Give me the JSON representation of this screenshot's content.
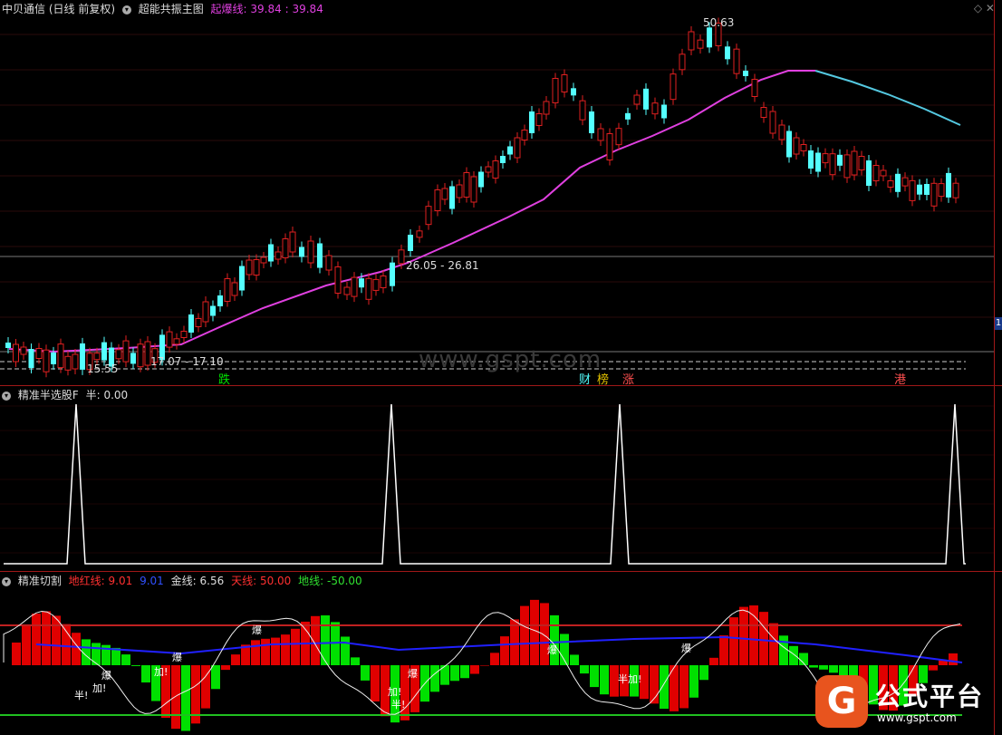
{
  "panel1": {
    "stock_name": "中贝通信",
    "period": "(日线 前复权)",
    "indicator": "超能共振主图",
    "line_label": "起爆线:",
    "value1": "39.84",
    "sep": ":",
    "value2": "39.84",
    "high_label": "50.63",
    "low_label": "15.55",
    "range1": "17.07 - 17.10",
    "range2": "26.05 - 26.81",
    "watermark": "www.gspt.com",
    "tags": [
      "跌",
      "财",
      "榜",
      "涨",
      "港"
    ],
    "right_marker": "1",
    "colors": {
      "up": "#e02020",
      "down": "#54ffff",
      "ma": "#e040e0",
      "ma_tail": "#54c8e0"
    }
  },
  "panel2": {
    "indicator": "精准半选股F",
    "series_label": "半:",
    "series_value": "0.00"
  },
  "panel3": {
    "indicator": "精准切割",
    "red_label": "地红线:",
    "red_value": "9.01",
    "blue_value": "9.01",
    "gold_label": "金线:",
    "gold_value": "6.56",
    "sky_label": "天线:",
    "sky_value": "50.00",
    "ground_label": "地线:",
    "ground_value": "-50.00",
    "labels": [
      "半!",
      "加!",
      "爆",
      "加!",
      "爆",
      "加!",
      "半!",
      "爆",
      "半加!",
      "爆",
      "爆"
    ],
    "colors": {
      "green": "#00e000",
      "red": "#e00000",
      "blue": "#2020ff",
      "topline": "#c02020",
      "bottomline": "#20c020"
    }
  },
  "branding": {
    "logo_char": "G",
    "name": "公式平台",
    "url": "www.gspt.com"
  }
}
